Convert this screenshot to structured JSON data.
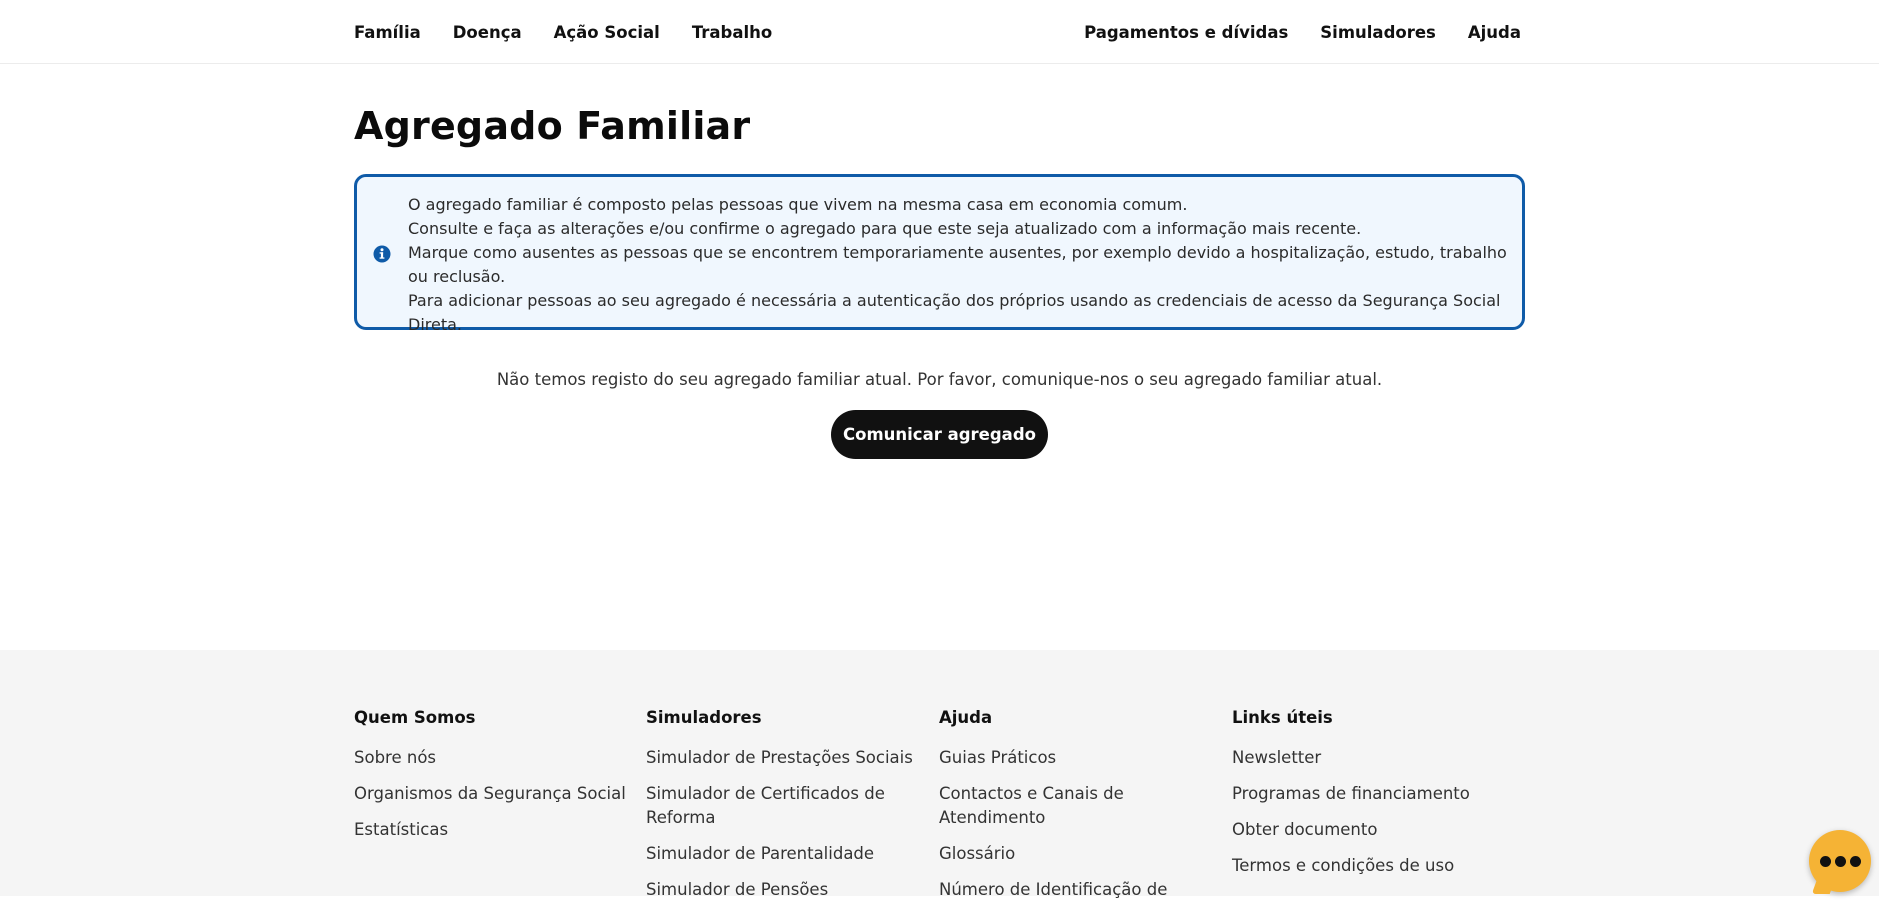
{
  "nav": {
    "left": [
      "Família",
      "Doença",
      "Ação Social",
      "Trabalho"
    ],
    "right": [
      "Pagamentos e dívidas",
      "Simuladores",
      "Ajuda"
    ]
  },
  "page": {
    "title": "Agregado Familiar"
  },
  "info": {
    "icon": "info-circle-icon",
    "accent": "#0f5ba8",
    "lines": [
      "O agregado familiar é composto pelas pessoas que vivem na mesma casa em economia comum.",
      "Consulte e faça as alterações e/ou confirme o agregado para que este seja atualizado com a informação mais recente.",
      "Marque como ausentes as pessoas que se encontrem temporariamente ausentes, por exemplo devido a hospitalização, estudo, trabalho ou reclusão.",
      "Para adicionar pessoas ao seu agregado é necessária a autenticação dos próprios usando as credenciais de acesso da Segurança Social Direta."
    ]
  },
  "empty": {
    "message": "Não temos registo do seu agregado familiar atual. Por favor, comunique-nos o seu agregado familiar atual.",
    "button": "Comunicar agregado"
  },
  "footer": {
    "columns": [
      {
        "title": "Quem Somos",
        "links": [
          "Sobre nós",
          "Organismos da Segurança Social",
          "Estatísticas"
        ]
      },
      {
        "title": "Simuladores",
        "links": [
          "Simulador de Prestações Sociais",
          "Simulador de Certificados de Reforma",
          "Simulador de Parentalidade",
          "Simulador de Pensões"
        ]
      },
      {
        "title": "Ajuda",
        "links": [
          "Guias Práticos",
          "Contactos e Canais de Atendimento",
          "Glossário",
          "Número de Identificação de"
        ]
      },
      {
        "title": "Links úteis",
        "links": [
          "Newsletter",
          "Programas de financiamento",
          "Obter documento",
          "Termos e condições de uso"
        ]
      }
    ]
  },
  "chat": {
    "icon": "chat-bubble-icon",
    "color": "#f5b335"
  }
}
